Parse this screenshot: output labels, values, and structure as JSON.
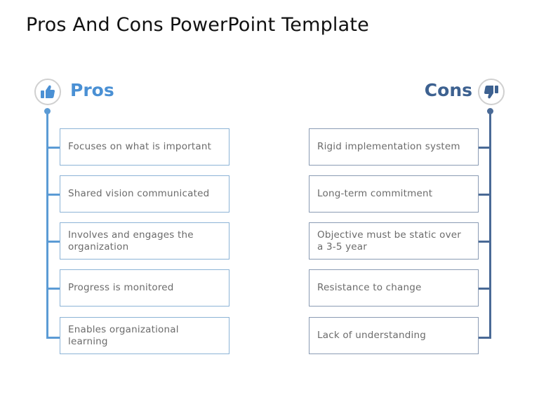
{
  "title": "Pros And Cons PowerPoint Template",
  "colors": {
    "pros_accent": "#4a90d4",
    "cons_accent": "#3d6190",
    "box_text": "#6b6b6b"
  },
  "pros": {
    "heading": "Pros",
    "icon": "thumbs-up-icon",
    "items": [
      "Focuses on what is important",
      "Shared vision communicated",
      "Involves and engages the organization",
      "Progress is monitored",
      "Enables organizational learning"
    ]
  },
  "cons": {
    "heading": "Cons",
    "icon": "thumbs-down-icon",
    "items": [
      "Rigid implementation system",
      "Long-term commitment",
      "Objective must be static over a 3-5 year",
      "Resistance to change",
      "Lack of understanding"
    ]
  }
}
